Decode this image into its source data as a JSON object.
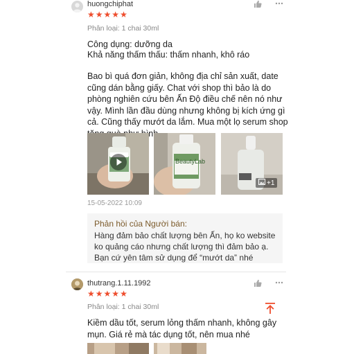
{
  "review1": {
    "username": "huongchiphat",
    "rating": 5,
    "variant": "Phân loại: 1 chai 30ml",
    "use_label": "Công dụng:",
    "use_value": "dưỡng da",
    "absorb_label": "Khả năng thấm thấu:",
    "absorb_value": "thấm nhanh, khô ráo",
    "text": "Bao bì quá đơn giản, không địa chỉ sản xuất, date cũng dán bằng giấy. Chat với shop thì bảo là do phòng nghiên cứu bên Ấn Độ điều chế nên nó như vậy. Mình lần đầu dùng nhưng không bị kích ứng gì cả. Cũng thấy mướt da lắm. Mua một lọ serum shop tặng quà như hình.",
    "photo_label": "BeautyLab",
    "more_photos": "+1",
    "date": "15-05-2022 10:09",
    "seller_reply_title": "Phản hồi của Người bán:",
    "seller_reply_text": "Hàng đảm bảo chất lượng bên Ấn, họ ko website ko quảng cáo nhưng chất lượng thì đảm bảo ạ. Bạn cứ yên tâm sử dụng để “mướt da” nhé"
  },
  "review2": {
    "username": "thutrang.1.11.1992",
    "rating": 5,
    "variant": "Phân loại: 1 chai 30ml",
    "text": "Kiềm dầu tốt, serum lỏng thấm nhanh, không gây mụn. Giá rẻ mà tác dụng tốt, nên mua nhé"
  },
  "icons": {
    "like": "thumbs-up-icon",
    "more": "more-dots-icon",
    "scroll_top": "arrow-up-icon",
    "play": "play-icon",
    "gallery": "image-icon",
    "star": "star-icon"
  },
  "colors": {
    "star": "#ee4d2d",
    "scroll_top": "#ee4d2d",
    "reply_bg": "#f5f5f5"
  }
}
